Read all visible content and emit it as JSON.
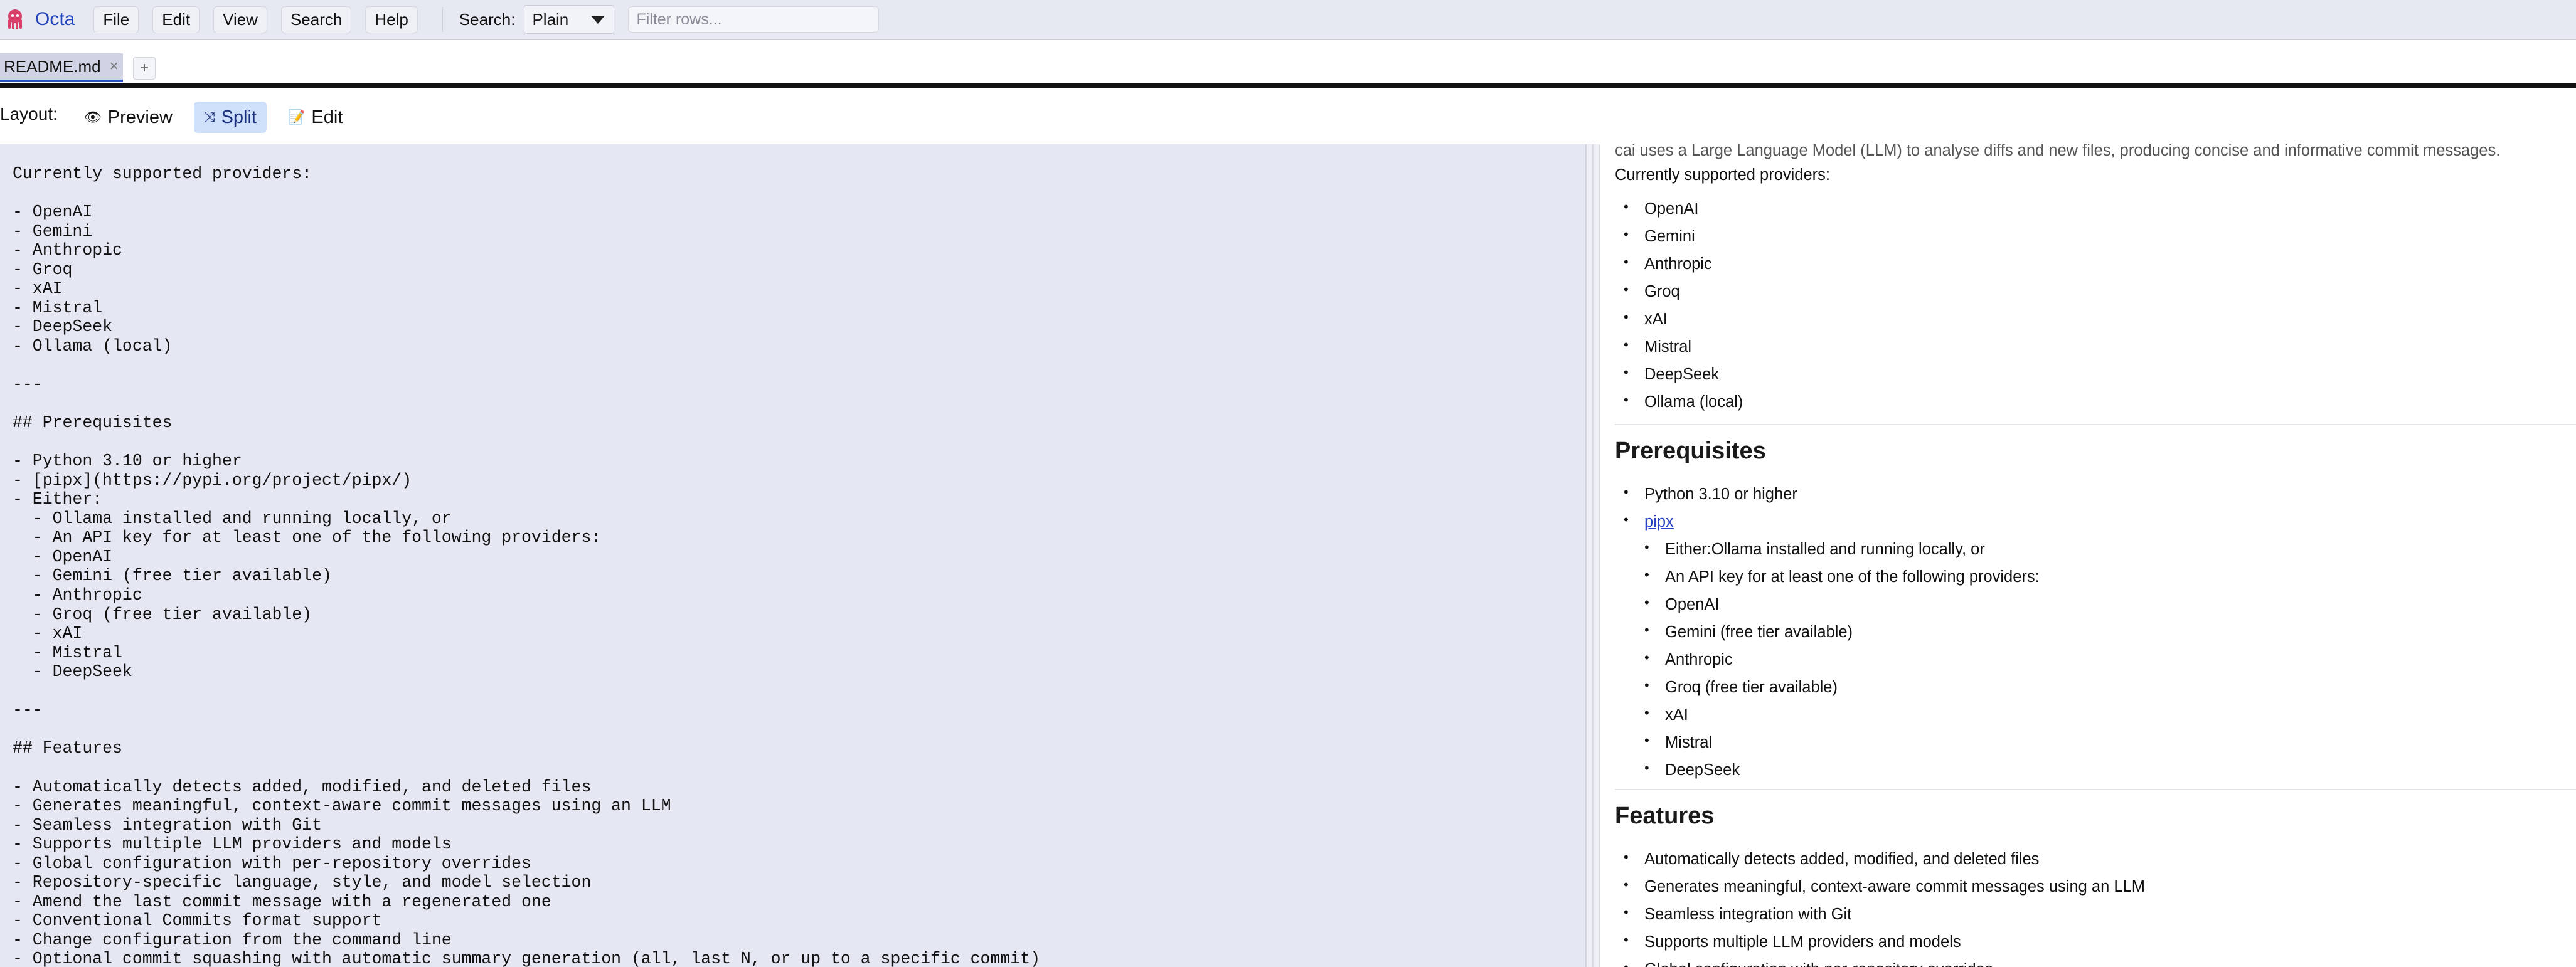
{
  "app": {
    "name": "Octa",
    "logo_icon": "octopus-icon",
    "brand_color": "#d8406a",
    "accent_color": "#2747b8"
  },
  "menu": {
    "items": [
      "File",
      "Edit",
      "View",
      "Search",
      "Help"
    ],
    "search_label": "Search:",
    "search_mode": "Plain",
    "filter_placeholder": "Filter rows..."
  },
  "tabs": {
    "items": [
      {
        "label": "README.md",
        "close": "×"
      }
    ],
    "add_label": "+"
  },
  "layout": {
    "label": "Layout:",
    "options": [
      {
        "label": "Preview",
        "icon": "eye-icon",
        "glyph": "👁"
      },
      {
        "label": "Split",
        "icon": "shuffle-icon",
        "glyph": "⤨",
        "active": true
      },
      {
        "label": "Edit",
        "icon": "edit-icon",
        "glyph": "📝"
      }
    ]
  },
  "editor": {
    "lines": [
      "Currently supported providers:",
      "",
      "- OpenAI",
      "- Gemini",
      "- Anthropic",
      "- Groq",
      "- xAI",
      "- Mistral",
      "- DeepSeek",
      "- Ollama (local)",
      "",
      "---",
      "",
      "## Prerequisites",
      "",
      "- Python 3.10 or higher",
      "- [pipx](https://pypi.org/project/pipx/)",
      "- Either:",
      "  - Ollama installed and running locally, or",
      "  - An API key for at least one of the following providers:",
      "  - OpenAI",
      "  - Gemini (free tier available)",
      "  - Anthropic",
      "  - Groq (free tier available)",
      "  - xAI",
      "  - Mistral",
      "  - DeepSeek",
      "",
      "---",
      "",
      "## Features",
      "",
      "- Automatically detects added, modified, and deleted files",
      "- Generates meaningful, context-aware commit messages using an LLM",
      "- Seamless integration with Git",
      "- Supports multiple LLM providers and models",
      "- Global configuration with per-repository overrides",
      "- Repository-specific language, style, and model selection",
      "- Amend the last commit message with a regenerated one",
      "- Conventional Commits format support",
      "- Change configuration from the command line",
      "- Optional commit squashing with automatic summary generation (all, last N, or up to a specific commit)"
    ]
  },
  "preview": {
    "intro": "cai uses a Large Language Model (LLM) to analyse diffs and new files, producing concise and informative commit messages.",
    "providers_heading": "Currently supported providers:",
    "providers": [
      "OpenAI",
      "Gemini",
      "Anthropic",
      "Groq",
      "xAI",
      "Mistral",
      "DeepSeek",
      "Ollama (local)"
    ],
    "prereq_heading": "Prerequisites",
    "prereq_items": [
      "Python 3.10 or higher"
    ],
    "prereq_link": "pipx",
    "prereq_nested": [
      "Either:Ollama installed and running locally, or",
      "An API key for at least one of the following providers:",
      "OpenAI",
      "Gemini (free tier available)",
      "Anthropic",
      "Groq (free tier available)",
      "xAI",
      "Mistral",
      "DeepSeek"
    ],
    "features_heading": "Features",
    "features": [
      "Automatically detects added, modified, and deleted files",
      "Generates meaningful, context-aware commit messages using an LLM",
      "Seamless integration with Git",
      "Supports multiple LLM providers and models",
      "Global configuration with per-repository overrides"
    ]
  }
}
